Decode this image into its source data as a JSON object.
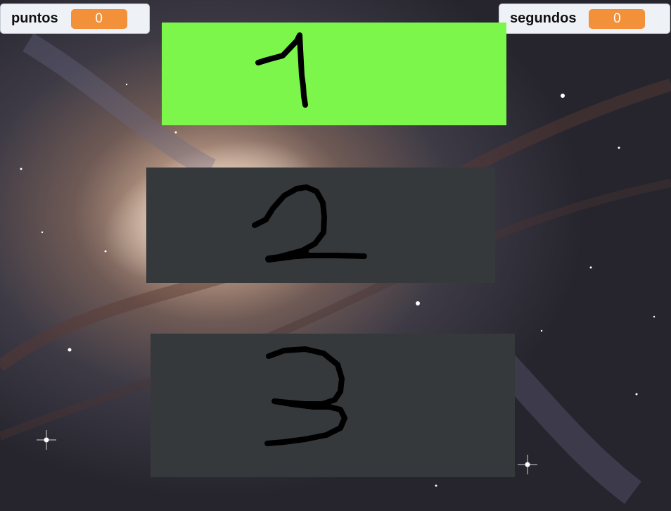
{
  "monitors": {
    "score": {
      "label": "puntos",
      "value": "0"
    },
    "timer": {
      "label": "segundos",
      "value": "0"
    }
  },
  "choices": [
    {
      "digit": "1",
      "state": "selected",
      "color": "#7cf64b"
    },
    {
      "digit": "2",
      "state": "idle",
      "color": "#36393b"
    },
    {
      "digit": "3",
      "state": "idle",
      "color": "#36393b"
    }
  ],
  "colors": {
    "monitor_value_bg": "#f2913a",
    "selected_card": "#7cf64b",
    "idle_card": "#36393b",
    "handwriting": "#000000"
  }
}
